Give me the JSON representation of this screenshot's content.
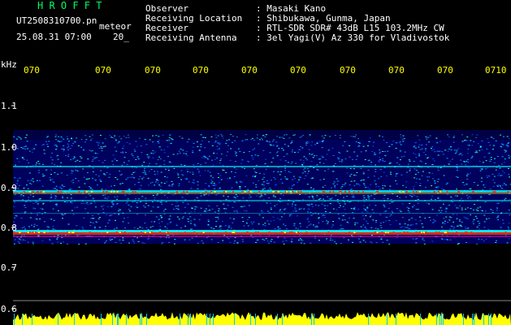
{
  "header": {
    "app_name": "H R O F F T",
    "file_name": "UT2508310700.pn",
    "mode": "meteor",
    "date_time": "25.08.31 07:00",
    "extra": "20_",
    "info_labels": [
      "Observer",
      "Receiving Location",
      "Receiver",
      "Receiving Antenna"
    ],
    "info_values": [
      ": Masaki Kano",
      ": Shibukawa, Gunma, Japan",
      ": RTL-SDR SDR# 43dB L15 103.2MHz CW",
      ": 3el Yagi(V) Az 330 for Vladivostok"
    ]
  },
  "axis": {
    "unit": "kHz",
    "time_ticks": [
      "070",
      "070",
      "070",
      "070",
      "070",
      "070",
      "070",
      "070",
      "070",
      "0710"
    ],
    "freq_ticks": [
      "1.1",
      "1.0",
      "0.9",
      "0.8",
      "0.7",
      "0.6"
    ]
  },
  "colors": {
    "background": "#000000",
    "label": "#ffffff",
    "app_name": "#00ff66",
    "time_label": "#ffff00",
    "signal_low": "#0000aa",
    "signal_mid": "#00ffff",
    "signal_high": "#ff3300",
    "power_trace": "#ffff00"
  }
}
